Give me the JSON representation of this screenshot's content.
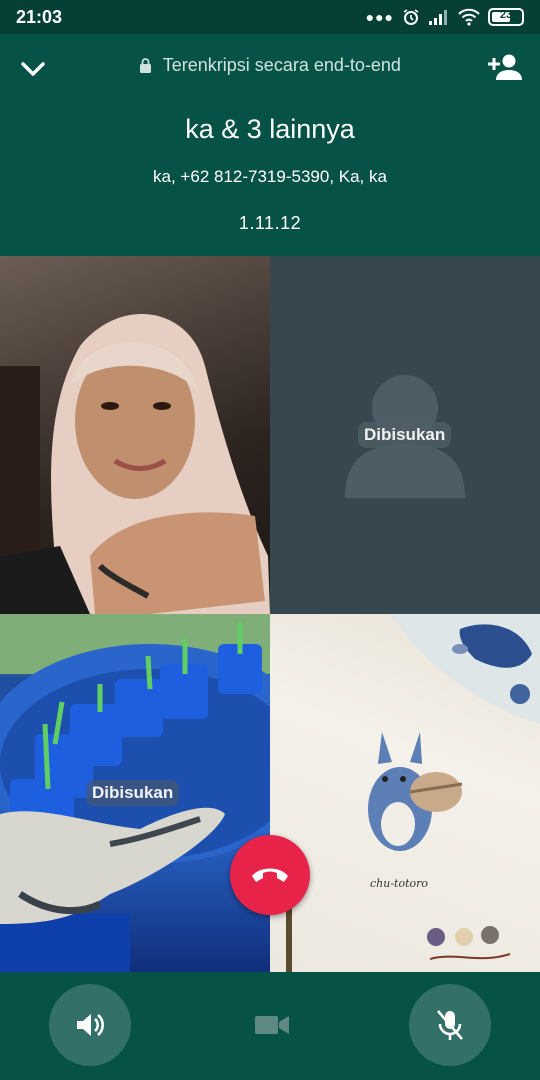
{
  "status_bar": {
    "time": "21:03",
    "battery": "23"
  },
  "header": {
    "encryption": "Terenkripsi secara end-to-end",
    "title": "ka & 3 lainnya",
    "participants": "ka, +62 812-7319-5390, Ka, ka",
    "duration": "1.11.12"
  },
  "tiles": {
    "top_right_status": "Dibisukan",
    "bottom_left_status": "Dibisukan",
    "painting_caption": "chu-totoro"
  },
  "colors": {
    "header": "#075247",
    "end_call": "#e8234a",
    "muted_tile": "#37474f"
  },
  "controls": {
    "speaker": "speaker-icon",
    "video": "video-icon",
    "mute": "mic-off-icon"
  }
}
